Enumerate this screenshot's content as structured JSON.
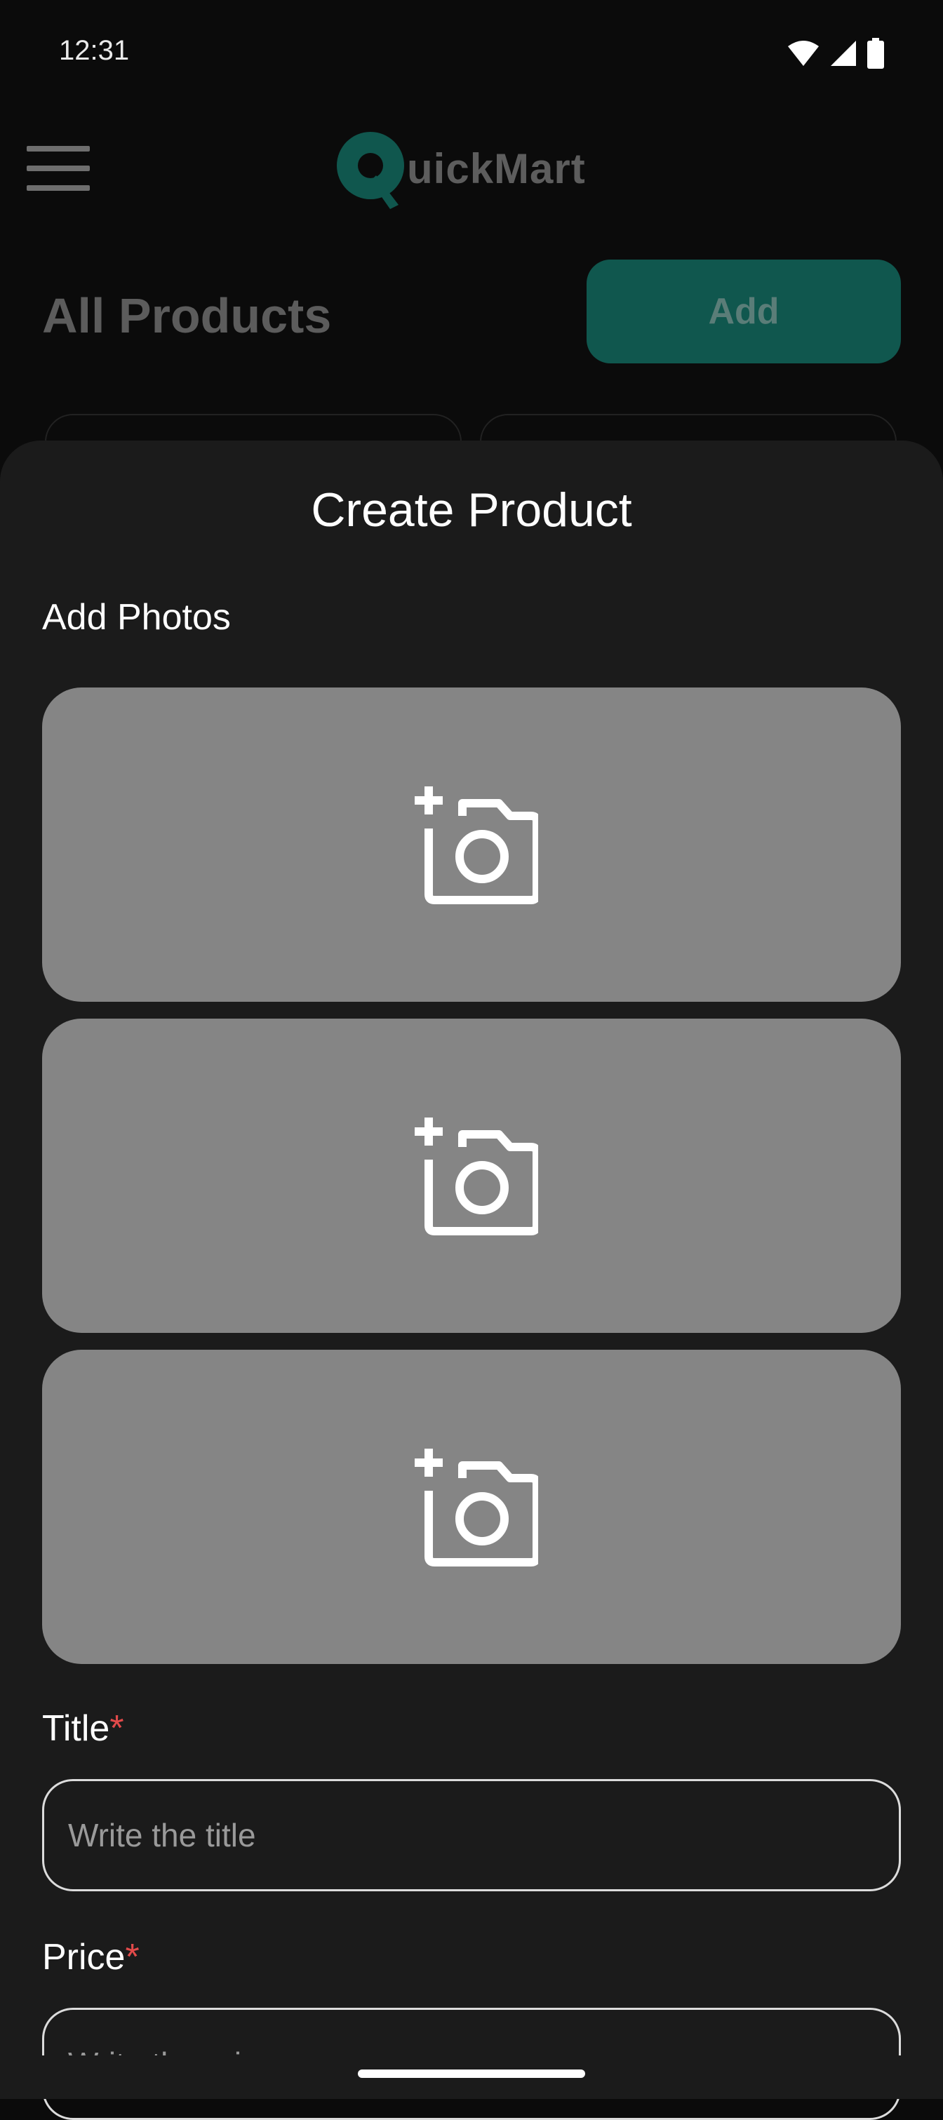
{
  "status_bar": {
    "time": "12:31",
    "icons": [
      "wifi-icon",
      "signal-icon",
      "battery-icon"
    ]
  },
  "app_bar": {
    "logo_text": "uickMart",
    "brand_color": "#10574e"
  },
  "heading": {
    "title": "All Products",
    "add_label": "Add"
  },
  "sheet": {
    "title": "Create Product",
    "photos_label": "Add Photos",
    "photo_slots": [
      "add-photo-icon",
      "add-photo-icon",
      "add-photo-icon"
    ],
    "title_field": {
      "label": "Title",
      "required_mark": "*",
      "placeholder": "Write the title",
      "value": ""
    },
    "price_field": {
      "label": "Price",
      "required_mark": "*",
      "placeholder": "Write the price",
      "value": ""
    }
  },
  "colors": {
    "sheet_bg": "#1b1b1b",
    "photo_slot_bg": "#858585",
    "required": "#e24a4a"
  }
}
